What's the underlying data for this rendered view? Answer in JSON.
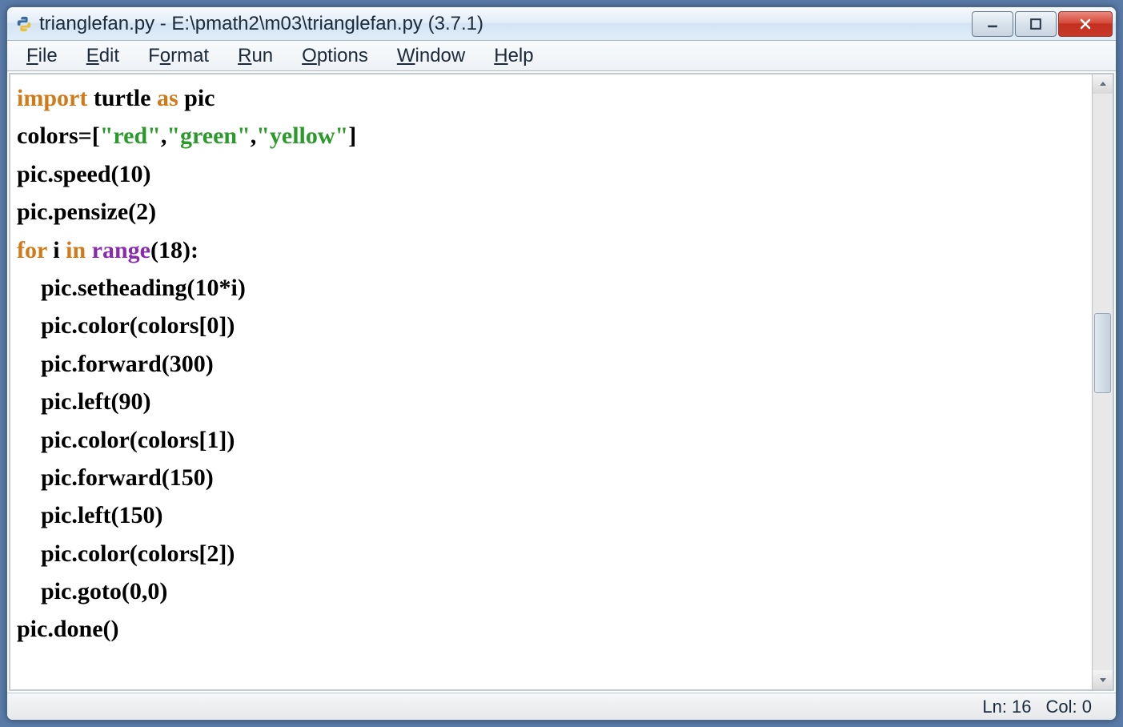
{
  "window": {
    "title": "trianglefan.py - E:\\pmath2\\m03\\trianglefan.py (3.7.1)"
  },
  "menubar": {
    "items": [
      {
        "label": "File",
        "accel": "F"
      },
      {
        "label": "Edit",
        "accel": "E"
      },
      {
        "label": "Format",
        "accel": "o"
      },
      {
        "label": "Run",
        "accel": "R"
      },
      {
        "label": "Options",
        "accel": "O"
      },
      {
        "label": "Window",
        "accel": "W"
      },
      {
        "label": "Help",
        "accel": "H"
      }
    ]
  },
  "code": {
    "lines": [
      {
        "type": "import",
        "kw1": "import",
        "mid": " turtle ",
        "kw2": "as",
        "tail": " pic"
      },
      {
        "type": "assign",
        "pre": "colors=[",
        "s1": "\"red\"",
        "c1": ",",
        "s2": "\"green\"",
        "c2": ",",
        "s3": "\"yellow\"",
        "post": "]"
      },
      {
        "type": "plain",
        "text": "pic.speed(10)"
      },
      {
        "type": "plain",
        "text": "pic.pensize(2)"
      },
      {
        "type": "for",
        "kw1": "for",
        "mid1": " i ",
        "kw2": "in",
        "mid2": " ",
        "fn": "range",
        "tail": "(18):"
      },
      {
        "type": "plain_indent",
        "indent": "    ",
        "text": "pic.setheading(10*i)"
      },
      {
        "type": "plain_indent",
        "indent": "    ",
        "text": "pic.color(colors[0])"
      },
      {
        "type": "plain_indent",
        "indent": "    ",
        "text": "pic.forward(300)"
      },
      {
        "type": "plain_indent",
        "indent": "    ",
        "text": "pic.left(90)"
      },
      {
        "type": "plain_indent",
        "indent": "    ",
        "text": "pic.color(colors[1])"
      },
      {
        "type": "plain_indent",
        "indent": "    ",
        "text": "pic.forward(150)"
      },
      {
        "type": "plain_indent",
        "indent": "    ",
        "text": "pic.left(150)"
      },
      {
        "type": "plain_indent",
        "indent": "    ",
        "text": "pic.color(colors[2])"
      },
      {
        "type": "plain_indent",
        "indent": "    ",
        "text": "pic.goto(0,0)"
      },
      {
        "type": "plain",
        "text": "pic.done()"
      }
    ]
  },
  "statusbar": {
    "line_label": "Ln: 16",
    "col_label": "Col: 0"
  },
  "syntax_colors": {
    "keyword_orange": "#d17a1a",
    "builtin_purple": "#8a2ab0",
    "string_green": "#2a9a2a",
    "text_black": "#000000"
  }
}
